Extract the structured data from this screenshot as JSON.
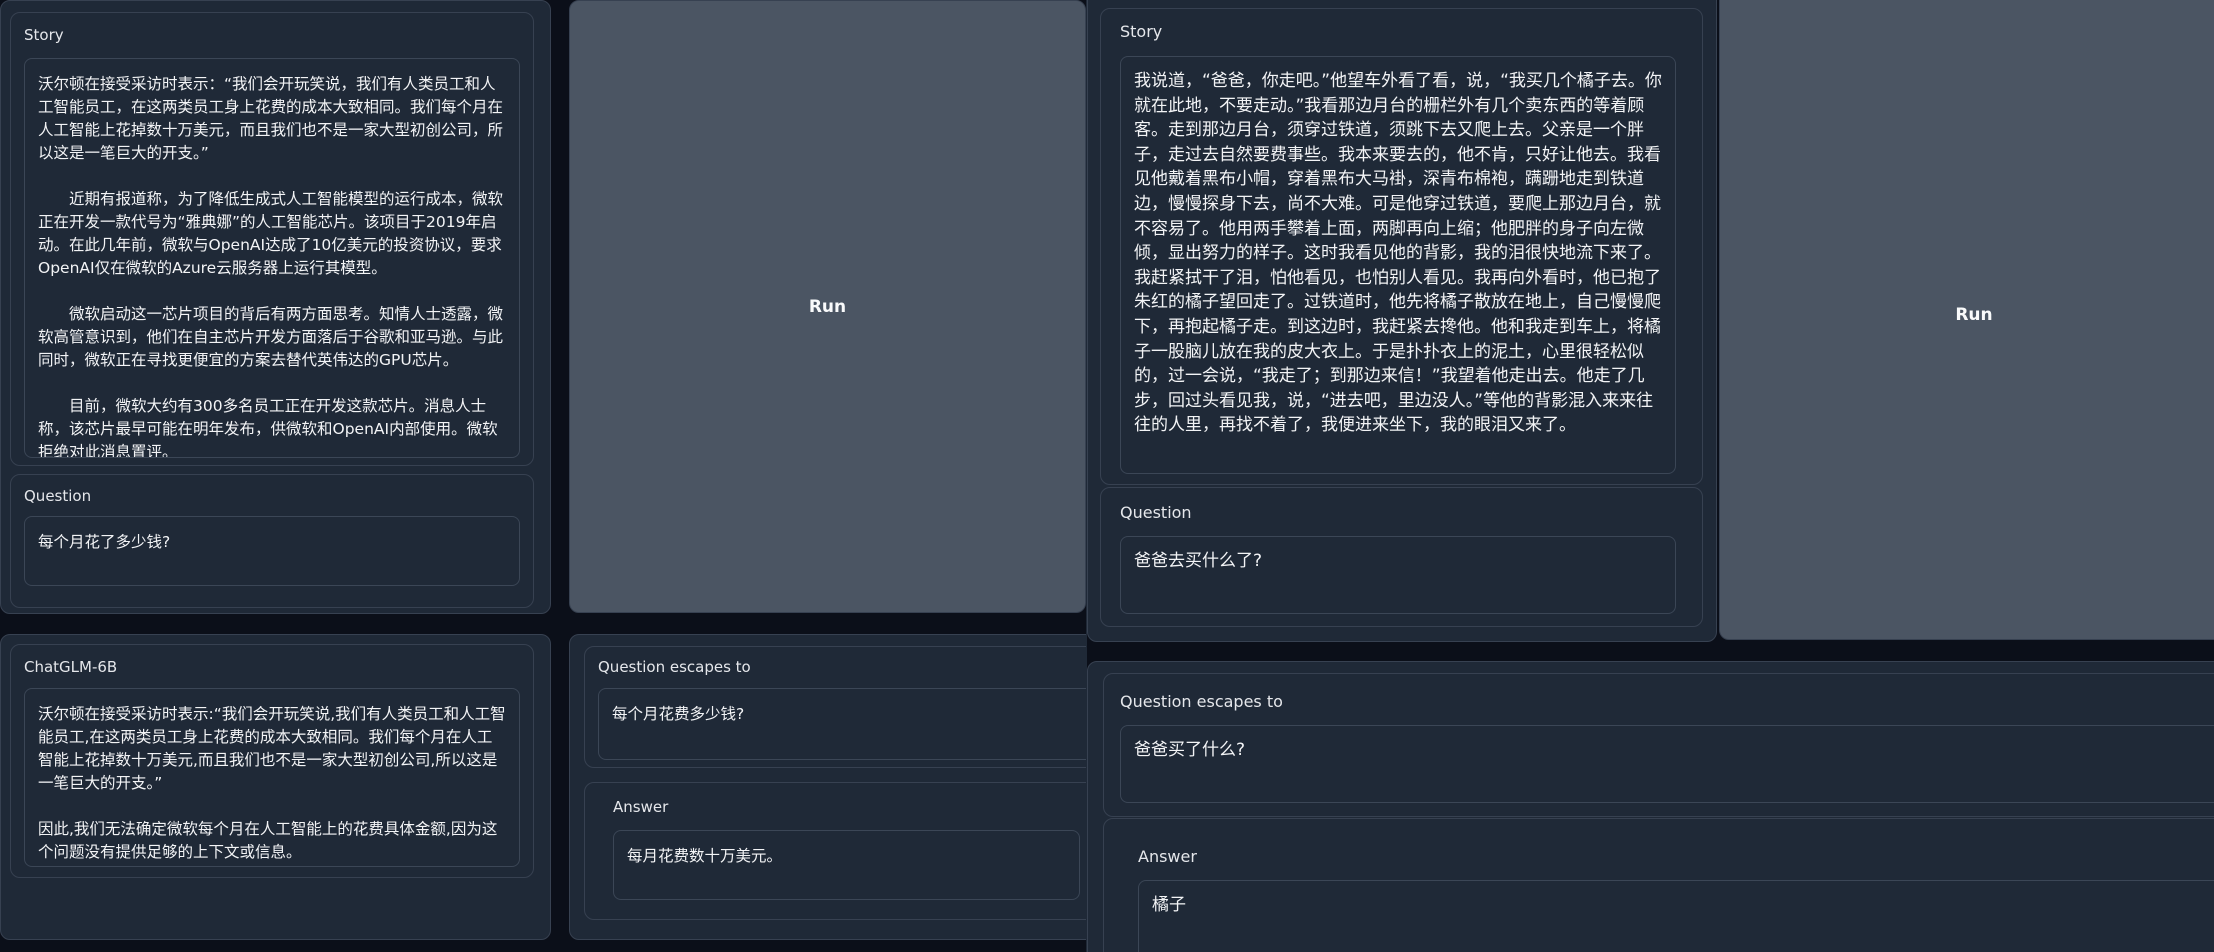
{
  "left": {
    "story_label": "Story",
    "story_paragraphs": [
      "沃尔顿在接受采访时表示：“我们会开玩笑说，我们有人类员工和人工智能员工，在这两类员工身上花费的成本大致相同。我们每个月在人工智能上花掉数十万美元，而且我们也不是一家大型初创公司，所以这是一笔巨大的开支。”",
      "近期有报道称，为了降低生成式人工智能模型的运行成本，微软正在开发一款代号为“雅典娜”的人工智能芯片。该项目于2019年启动。在此几年前，微软与OpenAI达成了10亿美元的投资协议，要求OpenAI仅在微软的Azure云服务器上运行其模型。",
      "微软启动这一芯片项目的背后有两方面思考。知情人士透露，微软高管意识到，他们在自主芯片开发方面落后于谷歌和亚马逊。与此同时，微软正在寻找更便宜的方案去替代英伟达的GPU芯片。",
      "目前，微软大约有300多名员工正在开发这款芯片。消息人士称，该芯片最早可能在明年发布，供微软和OpenAI内部使用。微软拒绝对此消息置评。"
    ],
    "question_label": "Question",
    "question_value": "每个月花了多少钱?",
    "run_label": "Run",
    "chatglm_label": "ChatGLM-6B",
    "chatglm_paragraphs": [
      "沃尔顿在接受采访时表示:“我们会开玩笑说,我们有人类员工和人工智能员工,在这两类员工身上花费的成本大致相同。我们每个月在人工智能上花掉数十万美元,而且我们也不是一家大型初创公司,所以这是一笔巨大的开支。”",
      "因此,我们无法确定微软每个月在人工智能上的花费具体金额,因为这个问题没有提供足够的上下文或信息。"
    ],
    "escape_label": "Question escapes to",
    "escape_value": "每个月花费多少钱?",
    "answer_label": "Answer",
    "answer_value": "每月花费数十万美元。"
  },
  "right": {
    "story_label": "Story",
    "story_text": "我说道，“爸爸，你走吧。”他望车外看了看，说，“我买几个橘子去。你就在此地，不要走动。”我看那边月台的栅栏外有几个卖东西的等着顾客。走到那边月台，须穿过铁道，须跳下去又爬上去。父亲是一个胖子，走过去自然要费事些。我本来要去的，他不肯，只好让他去。我看见他戴着黑布小帽，穿着黑布大马褂，深青布棉袍，蹒跚地走到铁道边，慢慢探身下去，尚不大难。可是他穿过铁道，要爬上那边月台，就不容易了。他用两手攀着上面，两脚再向上缩；他肥胖的身子向左微倾，显出努力的样子。这时我看见他的背影，我的泪很快地流下来了。我赶紧拭干了泪，怕他看见，也怕别人看见。我再向外看时，他已抱了朱红的橘子望回走了。过铁道时，他先将橘子散放在地上，自己慢慢爬下，再抱起橘子走。到这边时，我赶紧去搀他。他和我走到车上，将橘子一股脑儿放在我的皮大衣上。于是扑扑衣上的泥土，心里很轻松似的，过一会说，“我走了；到那边来信！”我望着他走出去。他走了几步，回过头看见我，说，“进去吧，里边没人。”等他的背影混入来来往往的人里，再找不着了，我便进来坐下，我的眼泪又来了。",
    "question_label": "Question",
    "question_value": "爸爸去买什么了?",
    "run_label": "Run",
    "escape_label": "Question escapes to",
    "escape_value": "爸爸买了什么?",
    "answer_label": "Answer",
    "answer_value": "橘子"
  }
}
